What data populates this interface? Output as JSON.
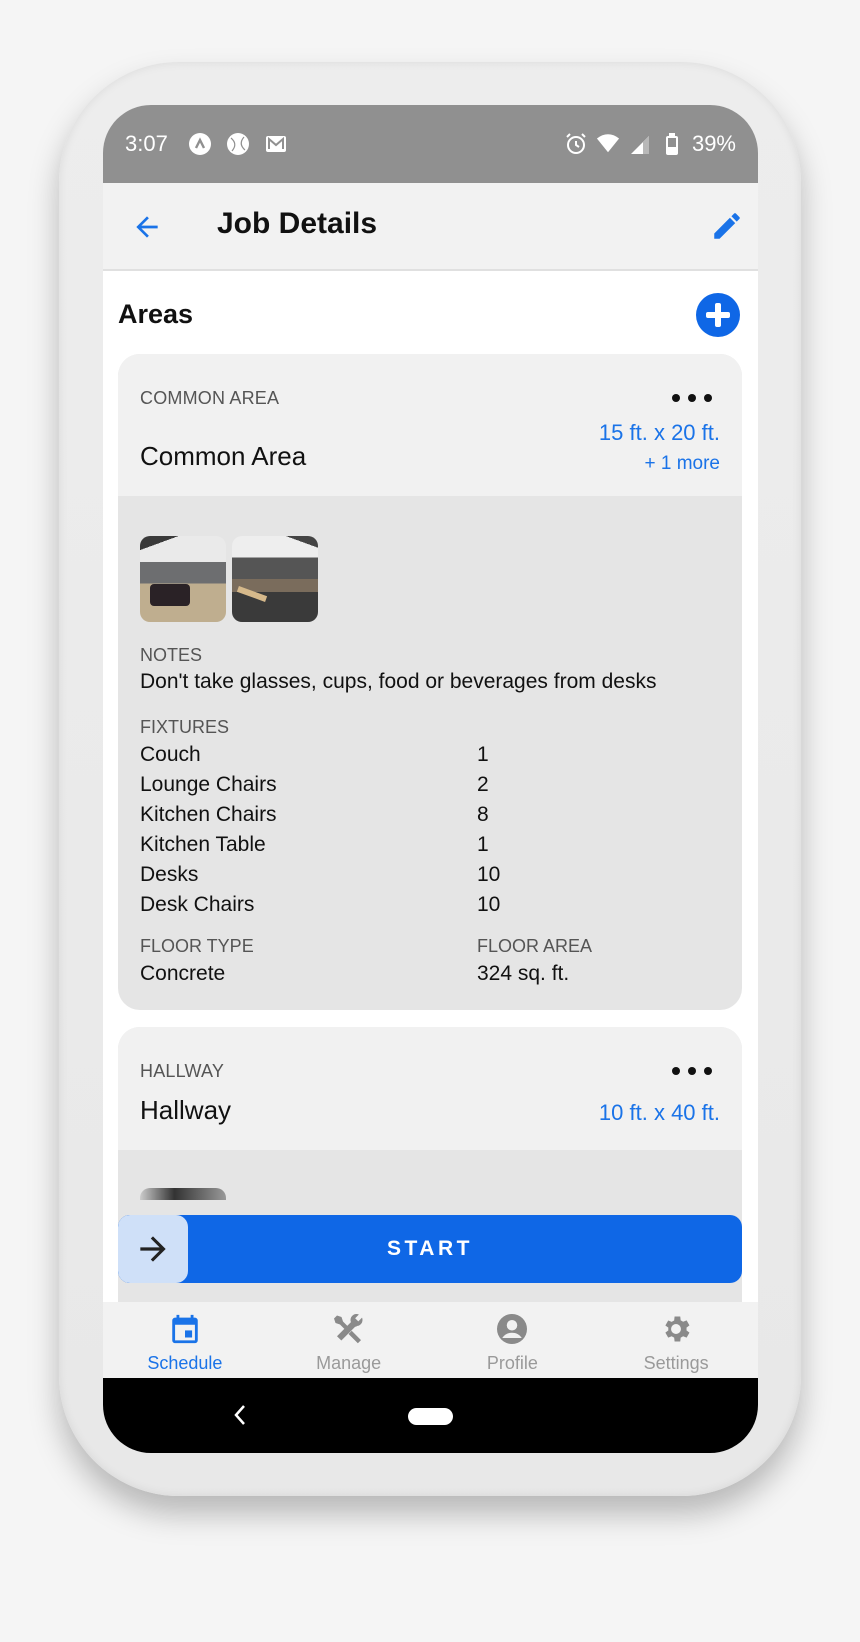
{
  "status_bar": {
    "time": "3:07",
    "left_icons": [
      "app-notification-icon",
      "sports-ball-icon",
      "gmail-icon"
    ],
    "right_icons": [
      "alarm-icon",
      "wifi-icon",
      "cell-signal-icon",
      "battery-icon"
    ],
    "battery": "39%"
  },
  "app_bar": {
    "title": "Job Details",
    "back_icon": "arrow-left-icon",
    "edit_icon": "pencil-icon"
  },
  "section": {
    "title": "Areas",
    "add_icon": "plus-circle-icon"
  },
  "areas": [
    {
      "type": "COMMON AREA",
      "name": "Common Area",
      "dimensions": "15 ft. x 20 ft.",
      "more_dimensions": "+ 1 more",
      "photos": [
        "lounge-photo",
        "kitchen-desks-photo"
      ],
      "notes_label": "NOTES",
      "notes": "Don't take glasses, cups, food or beverages from desks",
      "fixtures_label": "FIXTURES",
      "fixtures": [
        {
          "name": "Couch",
          "qty": "1"
        },
        {
          "name": "Lounge Chairs",
          "qty": "2"
        },
        {
          "name": "Kitchen Chairs",
          "qty": "8"
        },
        {
          "name": "Kitchen Table",
          "qty": "1"
        },
        {
          "name": "Desks",
          "qty": "10"
        },
        {
          "name": "Desk Chairs",
          "qty": "10"
        }
      ],
      "floor_type_label": "FLOOR TYPE",
      "floor_type": "Concrete",
      "floor_area_label": "FLOOR AREA",
      "floor_area": "324 sq. ft."
    },
    {
      "type": "HALLWAY",
      "name": "Hallway",
      "dimensions": "10 ft. x 40 ft."
    }
  ],
  "start_slider": {
    "label": "START",
    "handle_icon": "arrow-right-icon"
  },
  "bottom_nav": {
    "items": [
      {
        "label": "Schedule",
        "icon": "calendar-icon",
        "active": true
      },
      {
        "label": "Manage",
        "icon": "tools-icon",
        "active": false
      },
      {
        "label": "Profile",
        "icon": "account-circle-icon",
        "active": false
      },
      {
        "label": "Settings",
        "icon": "gear-icon",
        "active": false
      }
    ]
  },
  "colors": {
    "accent": "#0f67e6",
    "link": "#1a73e8",
    "status_bar": "#909090",
    "inactive_nav": "#9a9a9a"
  }
}
